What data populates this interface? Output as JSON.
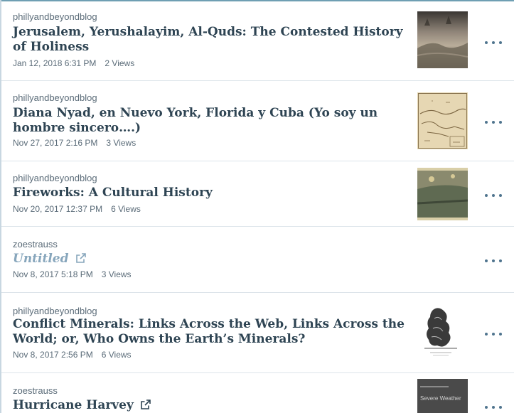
{
  "posts": [
    {
      "author": "phillyandbeyondblog",
      "title": "Jerusalem, Yerushalayim, Al-Quds: The Contested History of Holiness",
      "date": "Jan 12, 2018 6:31 PM",
      "views": "2 Views",
      "external": false,
      "thumbnail": "jerusalem-painting"
    },
    {
      "author": "phillyandbeyondblog",
      "title": "Diana Nyad, en Nuevo York, Florida y Cuba (Yo soy un hombre sincero….)",
      "date": "Nov 27, 2017 2:16 PM",
      "views": "3 Views",
      "external": false,
      "thumbnail": "old-map"
    },
    {
      "author": "phillyandbeyondblog",
      "title": "Fireworks: A Cultural History",
      "date": "Nov 20, 2017 12:37 PM",
      "views": "6 Views",
      "external": false,
      "thumbnail": "fireworks-painting"
    },
    {
      "author": "zoestrauss",
      "title": "Untitled",
      "date": "Nov 8, 2017 5:18 PM",
      "views": "3 Views",
      "external": true,
      "thumbnail": ""
    },
    {
      "author": "phillyandbeyondblog",
      "title": "Conflict Minerals: Links Across the Web, Links Across the World; or, Who Owns the Earth’s Minerals?",
      "date": "Nov 8, 2017 2:56 PM",
      "views": "6 Views",
      "external": false,
      "thumbnail": "engraving-illustration"
    },
    {
      "author": "zoestrauss",
      "title": "Hurricane Harvey",
      "date": "",
      "views": "",
      "external": true,
      "thumbnail": "severe-weather-card",
      "thumbnail_text": "Severe Weather"
    }
  ],
  "colors": {
    "title": "#2e4453",
    "untitled": "#87a6bc",
    "meta": "#5a6b78",
    "accent": "#6f9fb3",
    "more_dots": "#4f748e"
  },
  "icons": {
    "external": "external-link-icon",
    "more": "ellipsis-icon"
  }
}
